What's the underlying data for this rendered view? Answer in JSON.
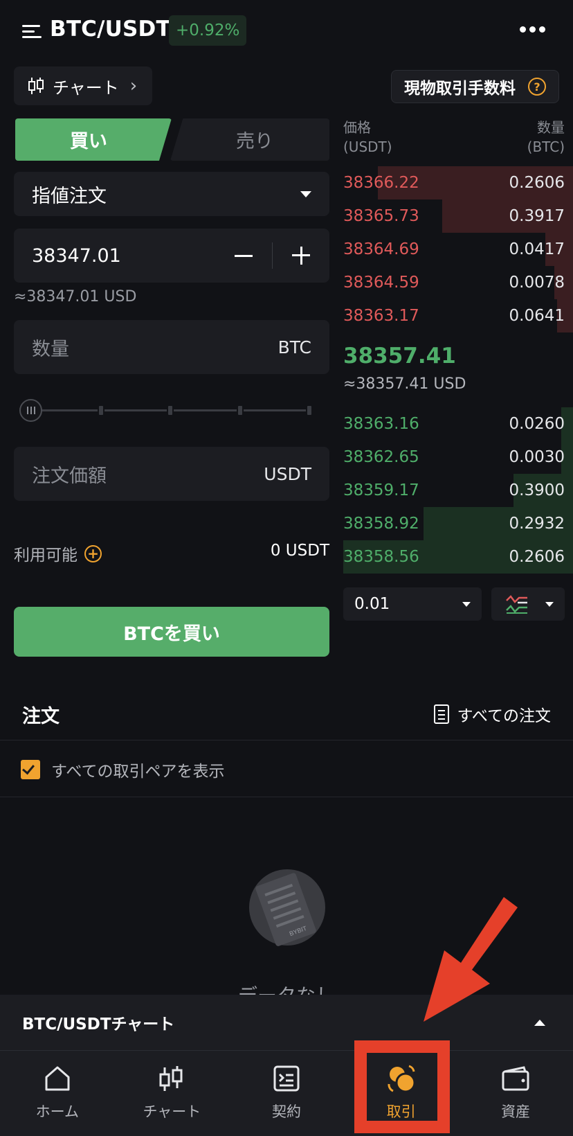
{
  "header": {
    "pair": "BTC/USDT",
    "change": "+0.92%"
  },
  "chart_button": {
    "label": "チャート"
  },
  "fee_button": {
    "label": "現物取引手数料"
  },
  "tabs": {
    "buy": "買い",
    "sell": "売り"
  },
  "order_form": {
    "order_type": "指値注文",
    "price": "38347.01",
    "price_usd": "≈38347.01 USD",
    "qty_placeholder": "数量",
    "qty_unit": "BTC",
    "total_placeholder": "注文価額",
    "total_unit": "USDT",
    "slider_percent": 0,
    "available_label": "利用可能",
    "available_value": "0 USDT",
    "submit": "BTCを買い"
  },
  "order_book": {
    "price_header": "価格",
    "price_unit": "(USDT)",
    "qty_header": "数量",
    "qty_unit": "(BTC)",
    "asks": [
      {
        "price": "38366.22",
        "qty": "0.2606",
        "depth": 0.85
      },
      {
        "price": "38365.73",
        "qty": "0.3917",
        "depth": 0.57
      },
      {
        "price": "38364.69",
        "qty": "0.0417",
        "depth": 0.12
      },
      {
        "price": "38364.59",
        "qty": "0.0078",
        "depth": 0.08
      },
      {
        "price": "38363.17",
        "qty": "0.0641",
        "depth": 0.07
      }
    ],
    "last_price": "38357.41",
    "last_price_usd": "≈38357.41 USD",
    "bids": [
      {
        "price": "38363.16",
        "qty": "0.0260",
        "depth": 0.05
      },
      {
        "price": "38362.65",
        "qty": "0.0030",
        "depth": 0.05
      },
      {
        "price": "38359.17",
        "qty": "0.3900",
        "depth": 0.26
      },
      {
        "price": "38358.92",
        "qty": "0.2932",
        "depth": 0.65
      },
      {
        "price": "38358.56",
        "qty": "0.2606",
        "depth": 1.0
      }
    ],
    "tick_size": "0.01"
  },
  "orders": {
    "title": "注文",
    "all_orders": "すべての注文",
    "show_all_pairs": "すべての取引ペアを表示",
    "empty_text": "データなし",
    "illustration_logo": "BYBIT"
  },
  "chart_bar": {
    "label": "BTC/USDTチャート"
  },
  "nav": [
    {
      "label": "ホーム",
      "icon": "home-icon"
    },
    {
      "label": "チャート",
      "icon": "candlestick-icon"
    },
    {
      "label": "契約",
      "icon": "contract-icon"
    },
    {
      "label": "取引",
      "icon": "trade-icon",
      "active": true
    },
    {
      "label": "資産",
      "icon": "wallet-icon"
    }
  ],
  "colors": {
    "background": "#111216",
    "panel": "#1c1d22",
    "buy_green": "#56ad6a",
    "sell_red": "#e05a5a",
    "accent": "#f0a32f",
    "annotation": "#e5402a"
  }
}
